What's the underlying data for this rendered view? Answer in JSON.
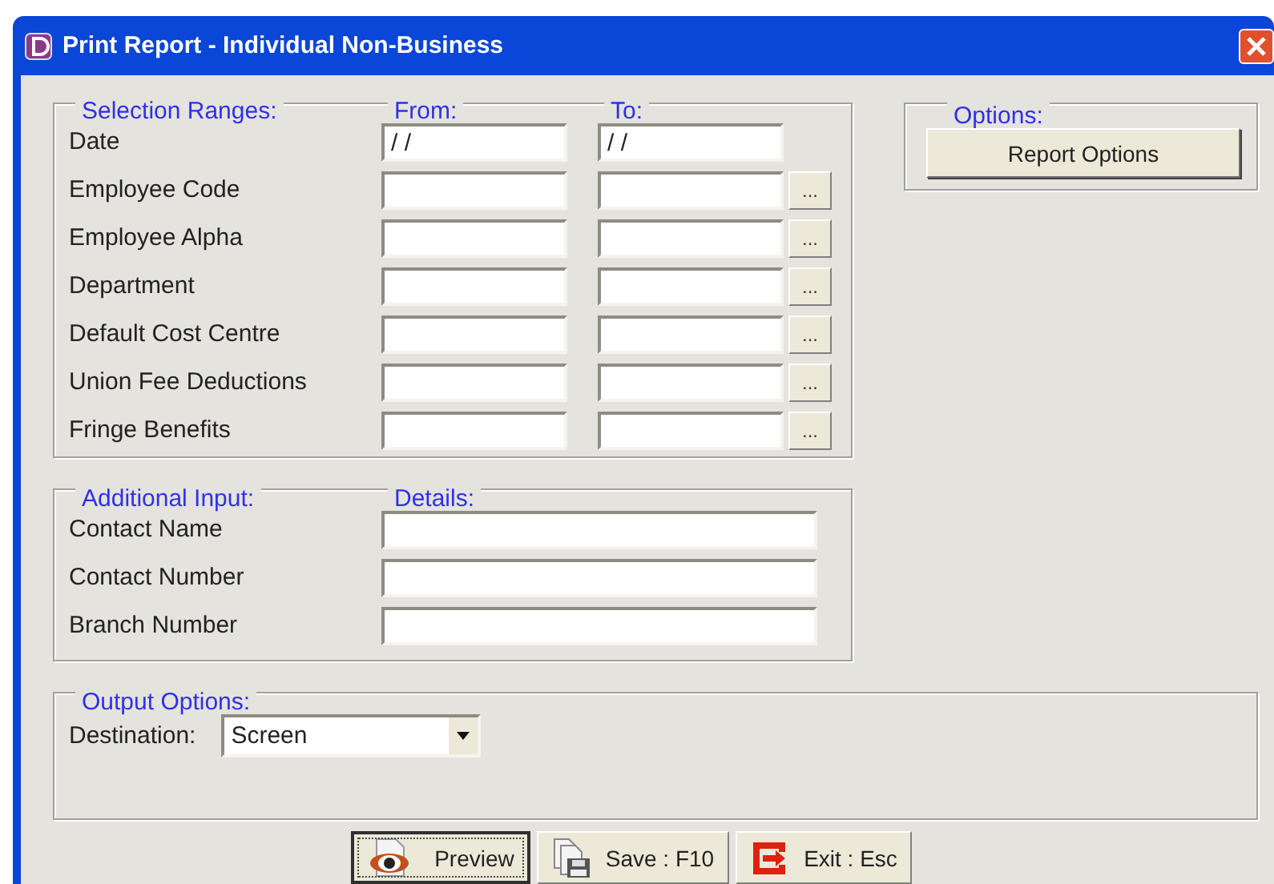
{
  "window": {
    "title": "Print Report - Individual Non-Business"
  },
  "selection_ranges": {
    "label": "Selection Ranges:",
    "from_label": "From:",
    "to_label": "To:",
    "rows": [
      {
        "label": "Date",
        "from": "/ /",
        "to": "/ /"
      },
      {
        "label": "Employee Code",
        "lookup": "..."
      },
      {
        "label": "Employee Alpha",
        "lookup": "..."
      },
      {
        "label": "Department",
        "lookup": "..."
      },
      {
        "label": "Default Cost Centre",
        "lookup": "..."
      },
      {
        "label": "Union Fee Deductions",
        "lookup": "..."
      },
      {
        "label": "Fringe Benefits",
        "lookup": "..."
      }
    ]
  },
  "options": {
    "label": "Options:",
    "button": {
      "label": "Report Options"
    }
  },
  "additional_input": {
    "label": "Additional Input:",
    "details_label": "Details:",
    "rows": [
      {
        "label": "Contact Name"
      },
      {
        "label": "Contact Number"
      },
      {
        "label": "Branch Number"
      }
    ]
  },
  "output_options": {
    "label": "Output Options:",
    "destination": {
      "label": "Destination:",
      "value": "Screen"
    }
  },
  "buttons": [
    {
      "label": "Preview",
      "kind": "preview",
      "focused": true
    },
    {
      "label": "Save : F10",
      "kind": "save",
      "focused": false
    },
    {
      "label": "Exit : Esc",
      "kind": "exit",
      "focused": false
    }
  ]
}
